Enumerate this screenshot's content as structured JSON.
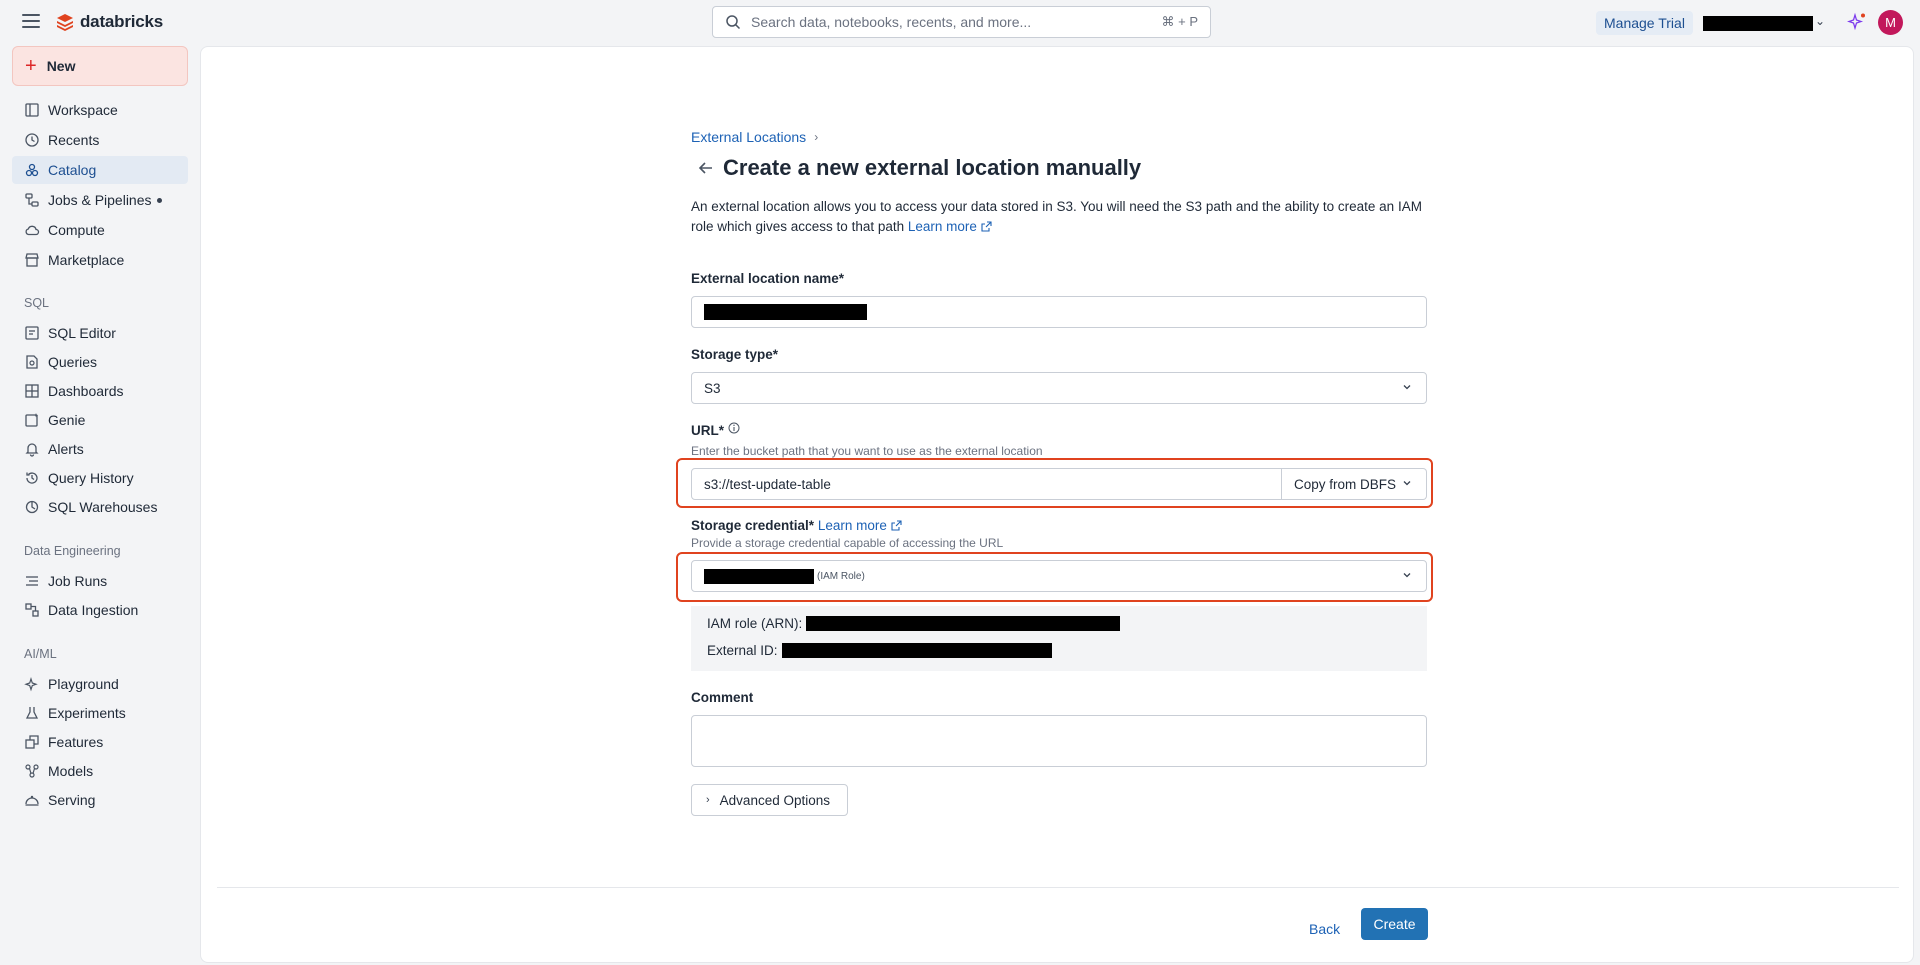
{
  "header": {
    "logo_text": "databricks",
    "search_placeholder": "Search data, notebooks, recents, and more...",
    "search_shortcut": "⌘ + P",
    "manage_trial_label": "Manage Trial",
    "avatar_initial": "M"
  },
  "sidebar": {
    "new_label": "New",
    "items_top": [
      {
        "label": "Workspace",
        "icon": "workspace-icon"
      },
      {
        "label": "Recents",
        "icon": "clock-icon"
      },
      {
        "label": "Catalog",
        "icon": "catalog-icon",
        "active": true
      },
      {
        "label": "Jobs & Pipelines",
        "icon": "jobs-icon"
      },
      {
        "label": "Compute",
        "icon": "cloud-icon"
      },
      {
        "label": "Marketplace",
        "icon": "store-icon"
      }
    ],
    "sql_section_label": "SQL",
    "items_sql": [
      {
        "label": "SQL Editor",
        "icon": "sql-editor-icon"
      },
      {
        "label": "Queries",
        "icon": "queries-icon"
      },
      {
        "label": "Dashboards",
        "icon": "dashboard-icon"
      },
      {
        "label": "Genie",
        "icon": "genie-icon"
      },
      {
        "label": "Alerts",
        "icon": "bell-icon"
      },
      {
        "label": "Query History",
        "icon": "history-icon"
      },
      {
        "label": "SQL Warehouses",
        "icon": "warehouse-icon"
      }
    ],
    "de_section_label": "Data Engineering",
    "items_de": [
      {
        "label": "Job Runs",
        "icon": "job-runs-icon"
      },
      {
        "label": "Data Ingestion",
        "icon": "ingestion-icon"
      }
    ],
    "ml_section_label": "AI/ML",
    "items_ml": [
      {
        "label": "Playground",
        "icon": "playground-icon"
      },
      {
        "label": "Experiments",
        "icon": "flask-icon"
      },
      {
        "label": "Features",
        "icon": "features-icon"
      },
      {
        "label": "Models",
        "icon": "models-icon"
      },
      {
        "label": "Serving",
        "icon": "serving-icon"
      }
    ]
  },
  "form": {
    "breadcrumb": "External Locations",
    "title": "Create a new external location manually",
    "description": "An external location allows you to access your data stored in S3. You will need the S3 path and the ability to create an IAM role which gives access to that path",
    "learn_more": "Learn more",
    "name_label": "External location name*",
    "storage_type_label": "Storage type*",
    "storage_type_value": "S3",
    "url_label": "URL*",
    "url_hint": "Enter the bucket path that you want to use as the external location",
    "url_value": "s3://test-update-table",
    "copy_from_dbfs": "Copy from DBFS",
    "credential_label": "Storage credential*",
    "credential_learn_more": "Learn more",
    "credential_hint": "Provide a storage credential capable of accessing the URL",
    "credential_type": "(IAM Role)",
    "iam_role_label": "IAM role (ARN):",
    "external_id_label": "External ID:",
    "comment_label": "Comment",
    "advanced_options": "Advanced Options",
    "back_label": "Back",
    "create_label": "Create"
  },
  "colors": {
    "accent": "#2272b4",
    "link": "#1d62b5",
    "highlight_outline": "#e0431f",
    "new_button_bg": "#fbe4e1"
  }
}
